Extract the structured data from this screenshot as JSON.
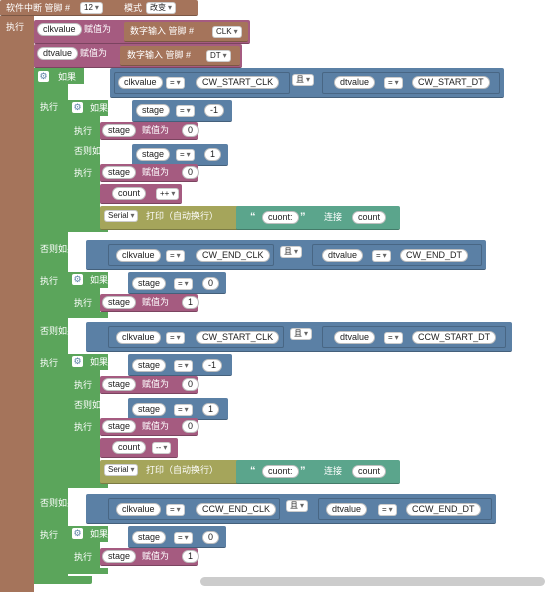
{
  "header": {
    "label": "软件中断 管脚 #",
    "pin": "12",
    "mode_label": "模式",
    "mode": "改变"
  },
  "labels": {
    "do": "执行",
    "if": "如果",
    "else_if": "否则如果",
    "assign": "赋值为",
    "digital_read": "数字输入 管脚 #",
    "and": "且",
    "eq": "=",
    "print": "打印（自动换行）",
    "join": "连接",
    "serial": "Serial",
    "inc": "++",
    "dec": "--"
  },
  "vars": {
    "clk": "clkvalue",
    "dt": "dtvalue",
    "stage": "stage",
    "count_var": "count",
    "count_text": "count",
    "cuont": "cuont:"
  },
  "pins": {
    "clk": "CLK",
    "dt": "DT"
  },
  "consts": {
    "cw_start_clk": "CW_START_CLK",
    "cw_start_dt": "CW_START_DT",
    "cw_end_clk": "CW_END_CLK",
    "cw_end_dt": "CW_END_DT",
    "ccw_start_dt": "CCW_START_DT",
    "ccw_end_clk": "CCW_END_CLK",
    "ccw_end_dt": "CCW_END_DT"
  },
  "nums": {
    "neg1": "-1",
    "zero": "0",
    "one": "1"
  },
  "colors": {
    "event": "#A5745B",
    "control": "#5BA55B",
    "logic": "#5B80A5",
    "variable": "#A55B80",
    "serial": "#A5A55B",
    "text": "#5BA58C"
  }
}
